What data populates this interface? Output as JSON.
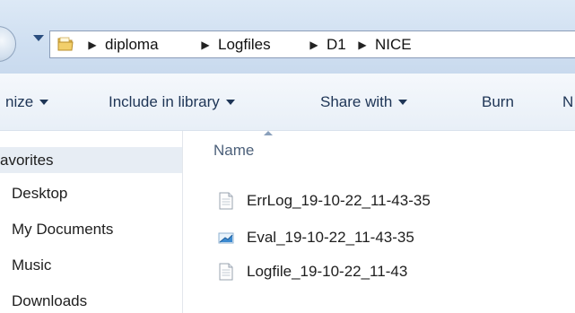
{
  "address": {
    "crumbs": [
      "diploma",
      "Logfiles",
      "D1",
      "NICE"
    ]
  },
  "toolbar": {
    "organize_label": "nize",
    "include_label": "Include in library",
    "share_label": "Share with",
    "burn_label": "Burn",
    "new_label": "N"
  },
  "nav": {
    "favorites_label": "avorites",
    "items": [
      "Desktop",
      "My Documents",
      "Music",
      "Downloads"
    ]
  },
  "list": {
    "name_header": "Name",
    "files": [
      {
        "name": "ErrLog_19-10-22_11-43-35",
        "icon": "text-file-icon"
      },
      {
        "name": "Eval_19-10-22_11-43-35",
        "icon": "image-file-icon"
      },
      {
        "name": "Logfile_19-10-22_11-43",
        "icon": "text-file-icon"
      }
    ]
  },
  "colors": {
    "address_bar_bg": "#cfdff1",
    "toolbar_text": "#1e3556",
    "selected_nav_bg": "#e7edf4"
  }
}
